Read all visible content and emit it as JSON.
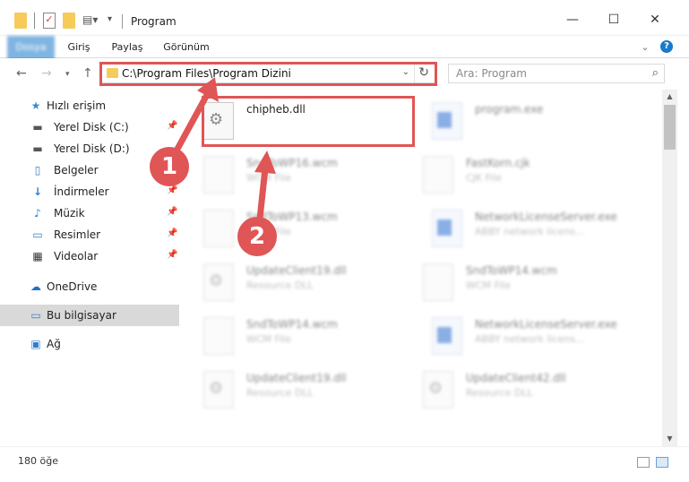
{
  "window": {
    "title": "Program",
    "minimize": "—",
    "maximize": "☐",
    "close": "✕"
  },
  "ribbon": {
    "tabs": [
      "Dosya",
      "Giriş",
      "Paylaş",
      "Görünüm"
    ],
    "expand": "⌄",
    "help": "?"
  },
  "address": {
    "path": "C:\\Program Files\\Program Dizini",
    "search_placeholder": "Ara: Program"
  },
  "sidebar": {
    "items": [
      {
        "label": "Hızlı erişim",
        "icon": "star-icon",
        "pinned": false
      },
      {
        "label": "Yerel Disk (C:)",
        "icon": "drive-icon",
        "pinned": true
      },
      {
        "label": "Yerel Disk (D:)",
        "icon": "drive-icon",
        "pinned": true
      },
      {
        "label": "Belgeler",
        "icon": "document-icon",
        "pinned": true
      },
      {
        "label": "İndirmeler",
        "icon": "download-icon",
        "pinned": true
      },
      {
        "label": "Müzik",
        "icon": "music-icon",
        "pinned": true
      },
      {
        "label": "Resimler",
        "icon": "pictures-icon",
        "pinned": true
      },
      {
        "label": "Videolar",
        "icon": "video-icon",
        "pinned": true
      },
      {
        "label": "OneDrive",
        "icon": "cloud-icon",
        "pinned": false
      },
      {
        "label": "Bu bilgisayar",
        "icon": "computer-icon",
        "pinned": false
      },
      {
        "label": "Ağ",
        "icon": "network-icon",
        "pinned": false
      }
    ]
  },
  "files": [
    {
      "name": "chipheb.dll",
      "type": "",
      "icon": "gear"
    },
    {
      "name": "program.exe",
      "type": "",
      "icon": "exe"
    },
    {
      "name": "SndToWP16.wcm",
      "type": "WCM File",
      "icon": "doc"
    },
    {
      "name": "FastKorn.cjk",
      "type": "CJK File",
      "icon": "doc"
    },
    {
      "name": "SndToWP13.wcm",
      "type": "WCM File",
      "icon": "doc"
    },
    {
      "name": "NetworkLicenseServer.exe",
      "type": "ABBY network licens...",
      "icon": "exe"
    },
    {
      "name": "UpdateClient19.dll",
      "type": "Resource DLL",
      "icon": "gear"
    },
    {
      "name": "SndToWP14.wcm",
      "type": "WCM File",
      "icon": "doc"
    },
    {
      "name": "SndToWP14.wcm",
      "type": "WCM File",
      "icon": "doc"
    },
    {
      "name": "NetworkLicenseServer.exe",
      "type": "ABBY network licens...",
      "icon": "exe"
    },
    {
      "name": "UpdateClient19.dll",
      "type": "Resource DLL",
      "icon": "gear"
    },
    {
      "name": "UpdateClient42.dll",
      "type": "Resource DLL",
      "icon": "gear"
    }
  ],
  "status": {
    "count": "180 öğe"
  },
  "annotations": {
    "step1": "1",
    "step2": "2",
    "color": "#e05555"
  }
}
